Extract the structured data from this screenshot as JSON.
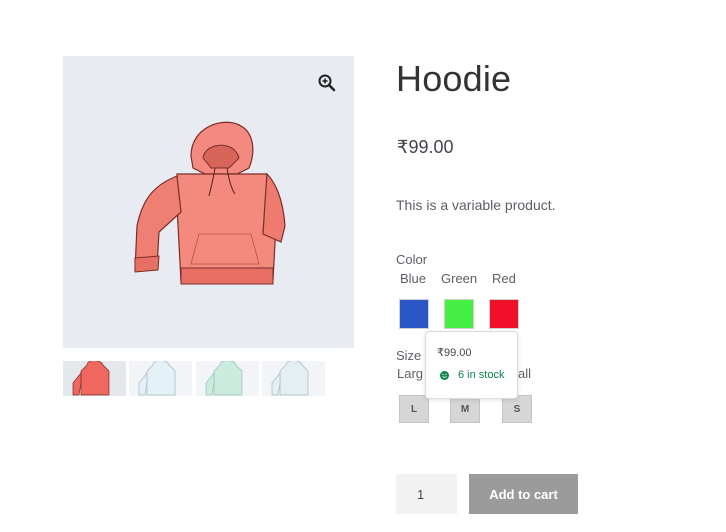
{
  "product": {
    "title": "Hoodie",
    "price": "₹99.00",
    "description": "This is a variable product."
  },
  "gallery": {
    "zoom_icon": "magnifier-plus-icon",
    "thumbnails": [
      {
        "color": "#f0675f"
      },
      {
        "color": "#cfe6f0"
      },
      {
        "color": "#9fdcc3"
      },
      {
        "color": "#cfe2ea"
      }
    ]
  },
  "color_attribute": {
    "label": "Color",
    "swatches": [
      {
        "name": "Blue",
        "color": "#2b57c6"
      },
      {
        "name": "Green",
        "color": "#45f045"
      },
      {
        "name": "Red",
        "color": "#f0102a"
      }
    ]
  },
  "size_attribute": {
    "label": "Size",
    "options_text_left": "Larg",
    "options_text_right": "all",
    "buttons": [
      "L",
      "M",
      "S"
    ]
  },
  "tooltip": {
    "price": "₹99.00",
    "stock": "6 in stock",
    "stock_icon": "smiley-icon"
  },
  "cart": {
    "quantity": "1",
    "add_label": "Add to cart"
  }
}
